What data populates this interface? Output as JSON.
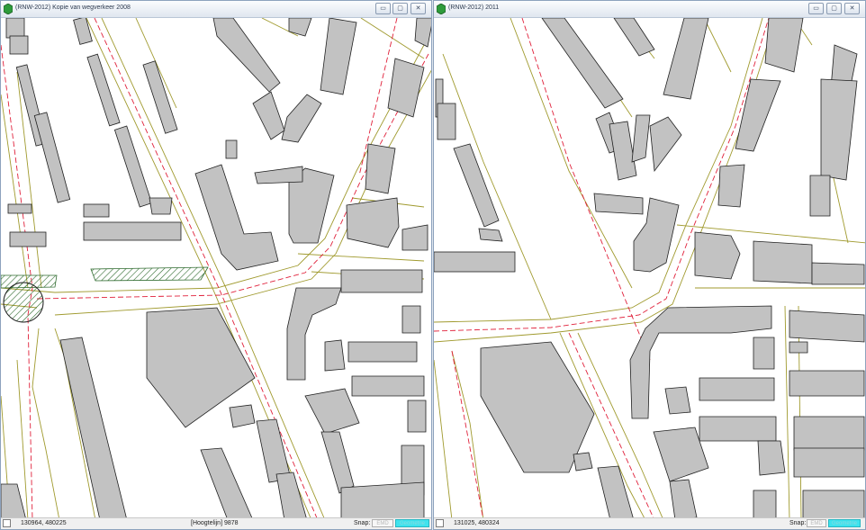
{
  "windows": [
    {
      "title": "(RNW-2012) Kopie van wegverkeer 2008",
      "status": {
        "coords": "130964, 480225",
        "layer": "[Hoogtelijn] 9878",
        "snap_label": "Snap:",
        "snap_opt1": "EMD",
        "snap_opt2": "Geometrie"
      }
    },
    {
      "title": "(RNW-2012) 2011",
      "status": {
        "coords": "131025, 480324",
        "snap_label": "Snap:",
        "snap_opt1": "EMD",
        "snap_opt2": "Geometrie"
      }
    }
  ],
  "controls": {
    "minimize": "▭",
    "maximize": "▢",
    "close": "✕"
  },
  "colors": {
    "building_fill": "#c2c2c2",
    "building_stroke": "#202020",
    "road_edge": "#a09a2e",
    "centerline": "#e0203a",
    "hatch": "#2f6b2f",
    "snap_active": "#3fe3ee"
  }
}
